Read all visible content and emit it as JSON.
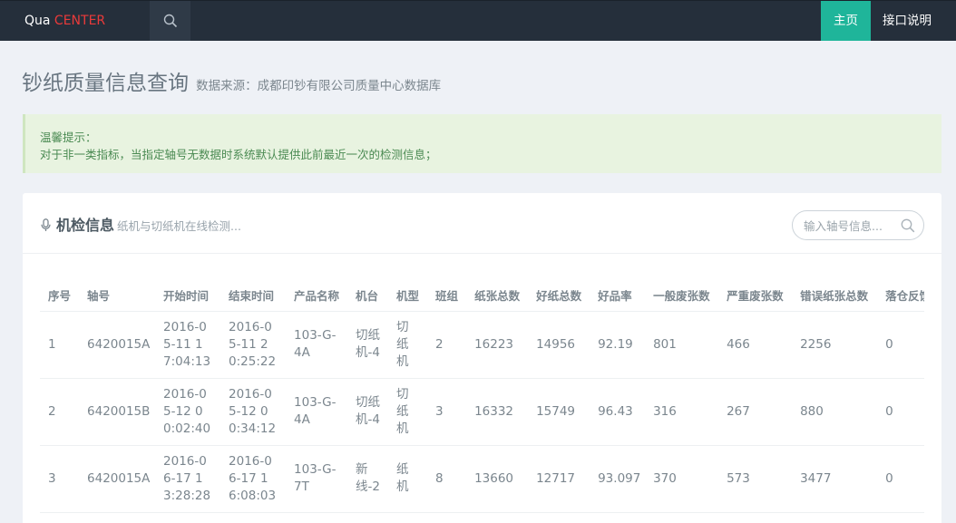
{
  "navbar": {
    "brand_prefix": "Qua ",
    "brand_accent": "CENTER",
    "items": [
      {
        "label": "主页"
      },
      {
        "label": "接口说明"
      }
    ]
  },
  "page": {
    "title": "钞纸质量信息查询",
    "subtitle": "数据来源：成都印钞有限公司质量中心数据库"
  },
  "alert": {
    "title": "温馨提示：",
    "text": "对于非一类指标，当指定轴号无数据时系统默认提供此前最近一次的检测信息；"
  },
  "panel": {
    "title": "机检信息",
    "subtitle": "纸机与切纸机在线检测...",
    "search_placeholder": "输入轴号信息..."
  },
  "table": {
    "headers": [
      "序号",
      "轴号",
      "开始时间",
      "结束时间",
      "产品名称",
      "机台",
      "机型",
      "班组",
      "纸张总数",
      "好纸总数",
      "好品率",
      "一般废张数",
      "严重废张数",
      "错误纸张总数",
      "落仓反馈"
    ],
    "rows": [
      [
        "1",
        "6420015A",
        "2016-05-11 17:04:13",
        "2016-05-11 20:25:22",
        "103-G-4A",
        "切纸机-4",
        "切纸机",
        "2",
        "16223",
        "14956",
        "92.19",
        "801",
        "466",
        "2256",
        "0"
      ],
      [
        "2",
        "6420015B",
        "2016-05-12 00:02:40",
        "2016-05-12 00:34:12",
        "103-G-4A",
        "切纸机-4",
        "切纸机",
        "3",
        "16332",
        "15749",
        "96.43",
        "316",
        "267",
        "880",
        "0"
      ],
      [
        "3",
        "6420015A",
        "2016-06-17 13:28:28",
        "2016-06-17 16:08:03",
        "103-G-7T",
        "新线-2",
        "纸机",
        "8",
        "13660",
        "12717",
        "93.097",
        "370",
        "573",
        "3477",
        "0"
      ]
    ]
  },
  "colors": {
    "navbar_bg": "#252f3b",
    "active_nav": "#1fb59a",
    "brand_accent": "#ea3a3a",
    "alert_bg": "#e8f3e0"
  }
}
